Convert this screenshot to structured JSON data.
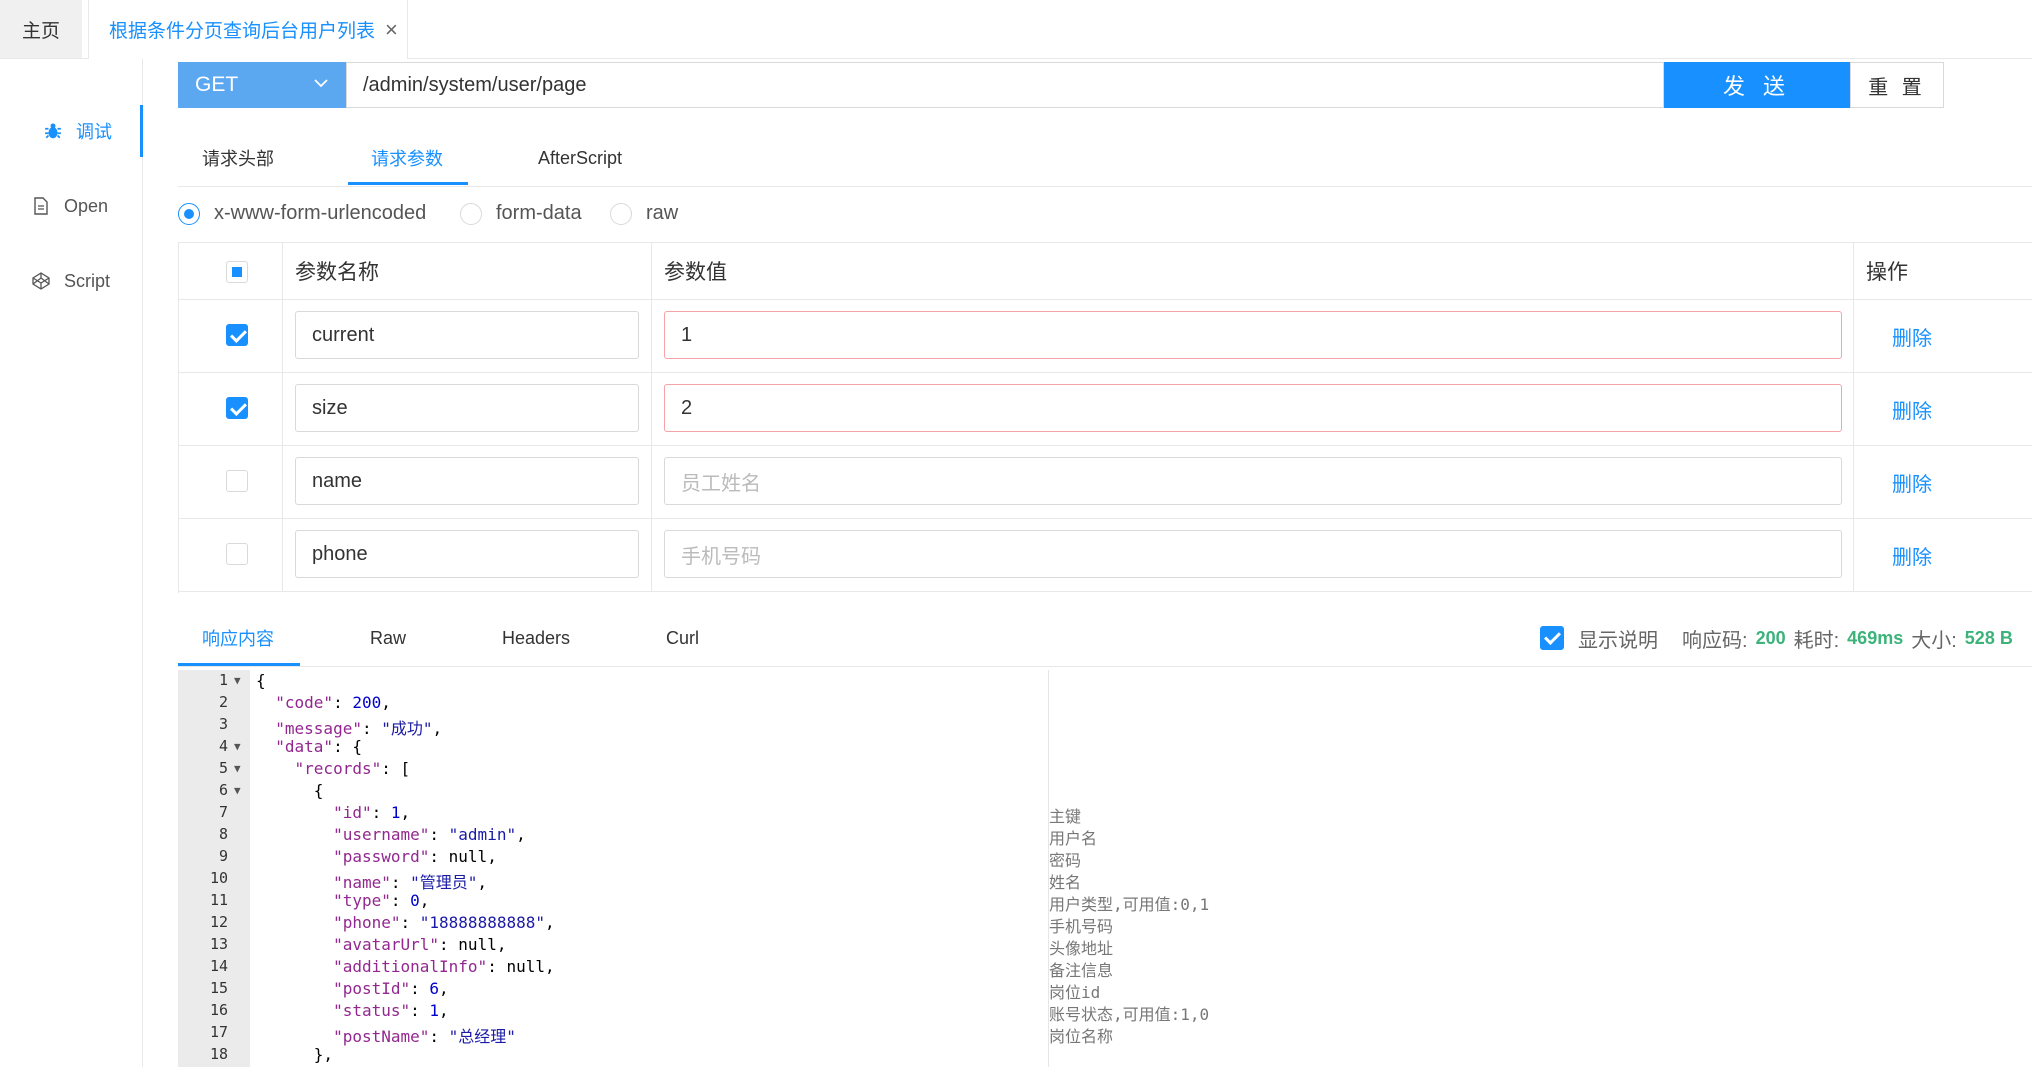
{
  "tabs": {
    "home": "主页",
    "active": "根据条件分页查询后台用户列表"
  },
  "sidebar": {
    "items": [
      {
        "label": "调试"
      },
      {
        "label": "Open"
      },
      {
        "label": "Script"
      }
    ]
  },
  "request": {
    "method": "GET",
    "url": "/admin/system/user/page",
    "send_label": "发 送",
    "reset_label": "重 置"
  },
  "subtabs": [
    "请求头部",
    "请求参数",
    "AfterScript"
  ],
  "body_types": [
    "x-www-form-urlencoded",
    "form-data",
    "raw"
  ],
  "params": {
    "headers": {
      "name": "参数名称",
      "value": "参数值",
      "action": "操作"
    },
    "rows": [
      {
        "checked": true,
        "name": "current",
        "value": "1",
        "placeholder": "",
        "delete": "删除"
      },
      {
        "checked": true,
        "name": "size",
        "value": "2",
        "placeholder": "",
        "delete": "删除"
      },
      {
        "checked": false,
        "name": "name",
        "value": "",
        "placeholder": "员工姓名",
        "delete": "删除"
      },
      {
        "checked": false,
        "name": "phone",
        "value": "",
        "placeholder": "手机号码",
        "delete": "删除"
      }
    ]
  },
  "response": {
    "tabs": [
      "响应内容",
      "Raw",
      "Headers",
      "Curl"
    ],
    "show_desc": "显示说明",
    "code_label": "响应码:",
    "code": "200",
    "time_label": "耗时:",
    "time": "469ms",
    "size_label": "大小:",
    "size": "528 B"
  },
  "code_lines": [
    {
      "n": "1",
      "t": "{"
    },
    {
      "n": "2",
      "t": "  \"code\": 200,"
    },
    {
      "n": "3",
      "t": "  \"message\": \"成功\","
    },
    {
      "n": "4",
      "t": "  \"data\": {"
    },
    {
      "n": "5",
      "t": "    \"records\": ["
    },
    {
      "n": "6",
      "t": "      {"
    },
    {
      "n": "7",
      "t": "        \"id\": 1,",
      "c": "主键"
    },
    {
      "n": "8",
      "t": "        \"username\": \"admin\",",
      "c": "用户名"
    },
    {
      "n": "9",
      "t": "        \"password\": null,",
      "c": "密码"
    },
    {
      "n": "10",
      "t": "        \"name\": \"管理员\",",
      "c": "姓名"
    },
    {
      "n": "11",
      "t": "        \"type\": 0,",
      "c": "用户类型,可用值:0,1"
    },
    {
      "n": "12",
      "t": "        \"phone\": \"18888888888\",",
      "c": "手机号码"
    },
    {
      "n": "13",
      "t": "        \"avatarUrl\": null,",
      "c": "头像地址"
    },
    {
      "n": "14",
      "t": "        \"additionalInfo\": null,",
      "c": "备注信息"
    },
    {
      "n": "15",
      "t": "        \"postId\": 6,",
      "c": "岗位id"
    },
    {
      "n": "16",
      "t": "        \"status\": 1,",
      "c": "账号状态,可用值:1,0"
    },
    {
      "n": "17",
      "t": "        \"postName\": \"总经理\"",
      "c": "岗位名称"
    },
    {
      "n": "18",
      "t": "      },"
    }
  ]
}
